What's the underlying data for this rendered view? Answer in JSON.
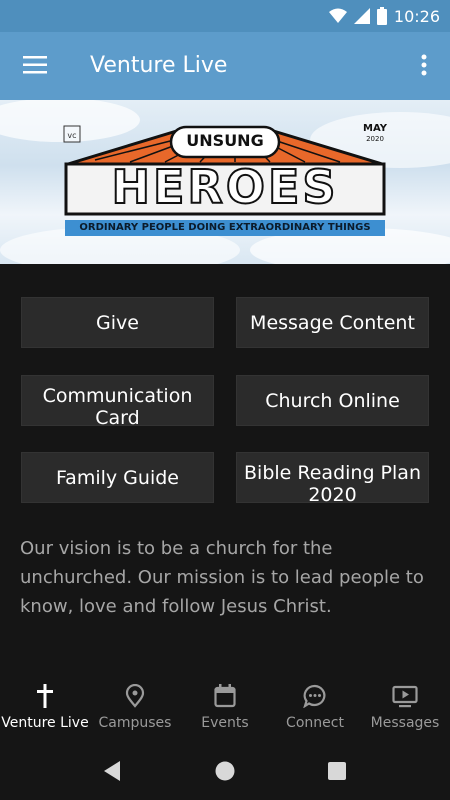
{
  "status_bar": {
    "time": "10:26"
  },
  "app_bar": {
    "title": "Venture Live"
  },
  "banner": {
    "badge": "UNSUNG",
    "month": "MAY",
    "year": "2020",
    "headline": "HEROES",
    "tagline": "ORDINARY PEOPLE DOING EXTRAORDINARY THINGS"
  },
  "tiles": [
    {
      "label": "Give"
    },
    {
      "label": "Message Content"
    },
    {
      "label": "Communication Card"
    },
    {
      "label": "Church Online"
    },
    {
      "label": "Family Guide"
    },
    {
      "label": "Bible Reading Plan 2020"
    }
  ],
  "vision_text": "Our vision is to be a church for the unchurched. Our mission is to lead people to know, love and follow Jesus Christ.",
  "bottom_nav": [
    {
      "label": "Venture Live",
      "icon": "cross-icon",
      "active": true
    },
    {
      "label": "Campuses",
      "icon": "location-pin-icon",
      "active": false
    },
    {
      "label": "Events",
      "icon": "calendar-icon",
      "active": false
    },
    {
      "label": "Connect",
      "icon": "chat-bubble-icon",
      "active": false
    },
    {
      "label": "Messages",
      "icon": "video-play-icon",
      "active": false
    }
  ],
  "colors": {
    "status_bar": "#4f8fbd",
    "app_bar": "#5d9ccb",
    "background": "#151515",
    "tile": "#2b2b2b",
    "muted_text": "#a6a6a6",
    "banner_orange": "#e8682a",
    "banner_blue": "#3d8fd1"
  }
}
